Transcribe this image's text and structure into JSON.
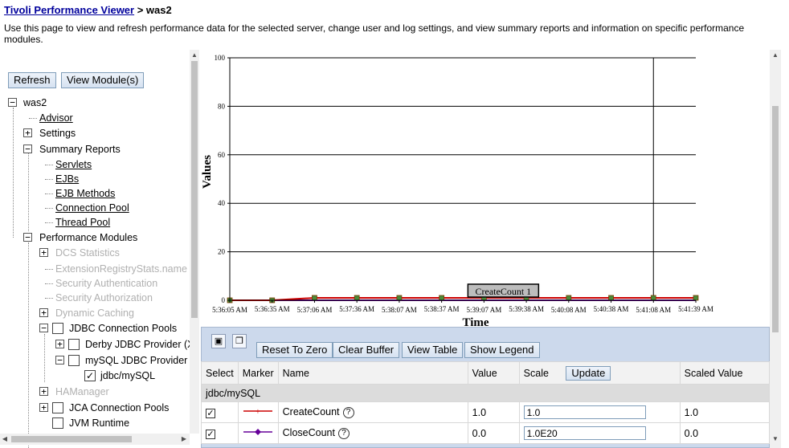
{
  "header": {
    "crumb_link": "Tivoli Performance Viewer",
    "crumb_sep": " > ",
    "crumb_current": "was2",
    "description": "Use this page to view and refresh performance data for the selected server, change user and log settings, and view summary reports and information on specific performance modules."
  },
  "toolbar": {
    "refresh": "Refresh",
    "view_modules": "View Module(s)"
  },
  "tree": {
    "root": "was2",
    "advisor": "Advisor",
    "settings": "Settings",
    "summary_reports": "Summary Reports",
    "servlets": "Servlets",
    "ejbs": "EJBs",
    "ejb_methods": "EJB Methods",
    "connection_pool": "Connection Pool",
    "thread_pool": "Thread Pool",
    "performance_modules": "Performance Modules",
    "dcs_statistics": "DCS Statistics",
    "extension_registry": "ExtensionRegistryStats.name",
    "security_authentication": "Security Authentication",
    "security_authorization": "Security Authorization",
    "dynamic_caching": "Dynamic Caching",
    "jdbc_connection_pools": "JDBC Connection Pools",
    "derby_provider": "Derby JDBC Provider (X",
    "mysql_provider": "mySQL JDBC Provider",
    "jdbc_mysql": "jdbc/mySQL",
    "hamanager": "HAManager",
    "jca_connection_pools": "JCA Connection Pools",
    "jvm_runtime": "JVM Runtime"
  },
  "chart_data": {
    "type": "line",
    "ylabel": "Values",
    "xlabel": "Time",
    "ylim": [
      0,
      100
    ],
    "yticks": [
      "0",
      "20",
      "40",
      "60",
      "80",
      "100"
    ],
    "x": [
      "5:36:05 AM",
      "5:36:35 AM",
      "5:37:06 AM",
      "5:37:36 AM",
      "5:38:07 AM",
      "5:38:37 AM",
      "5:39:07 AM",
      "5:39:38 AM",
      "5:40:08 AM",
      "5:40:38 AM",
      "5:41:08 AM",
      "5:41:39 AM"
    ],
    "series": [
      {
        "name": "CreateCount",
        "values": [
          0,
          0,
          1,
          1,
          1,
          1,
          1,
          1,
          1,
          1,
          1,
          1
        ],
        "color": "#cc0000"
      },
      {
        "name": "CloseCount",
        "values": [
          0,
          0,
          0,
          0,
          0,
          0,
          0,
          0,
          0,
          0,
          0,
          0
        ],
        "color": "#660099"
      }
    ],
    "tooltip": "CreateCount 1",
    "grid": true
  },
  "panel": {
    "reset_label": "Reset To Zero",
    "clear_label": "Clear Buffer",
    "table_label": "View Table",
    "legend_label": "Show Legend"
  },
  "table": {
    "headers": {
      "select": "Select",
      "marker": "Marker",
      "name": "Name",
      "value": "Value",
      "scale": "Scale",
      "update": "Update",
      "scaled": "Scaled Value"
    },
    "group": "jdbc/mySQL",
    "rows": [
      {
        "name": "CreateCount",
        "value": "1.0",
        "scale": "1.0",
        "scaled": "1.0",
        "color": "#cc0000"
      },
      {
        "name": "CloseCount",
        "value": "0.0",
        "scale": "1.0E20",
        "scaled": "0.0",
        "color": "#660099"
      }
    ]
  }
}
